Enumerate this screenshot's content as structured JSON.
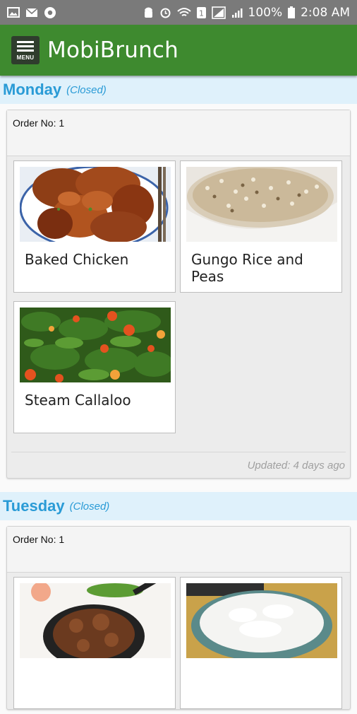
{
  "status_bar": {
    "battery": "100%",
    "time": "2:08 AM"
  },
  "app_bar": {
    "menu_label": "MENU",
    "title": "MobiBrunch"
  },
  "days": [
    {
      "name": "Monday",
      "status": "(Closed)",
      "order_label": "Order No: 1",
      "items": [
        "Baked Chicken",
        "Gungo Rice and Peas",
        "Steam Callaloo"
      ],
      "updated": "Updated: 4 days ago"
    },
    {
      "name": "Tuesday",
      "status": "(Closed)",
      "order_label": "Order No: 1"
    }
  ]
}
